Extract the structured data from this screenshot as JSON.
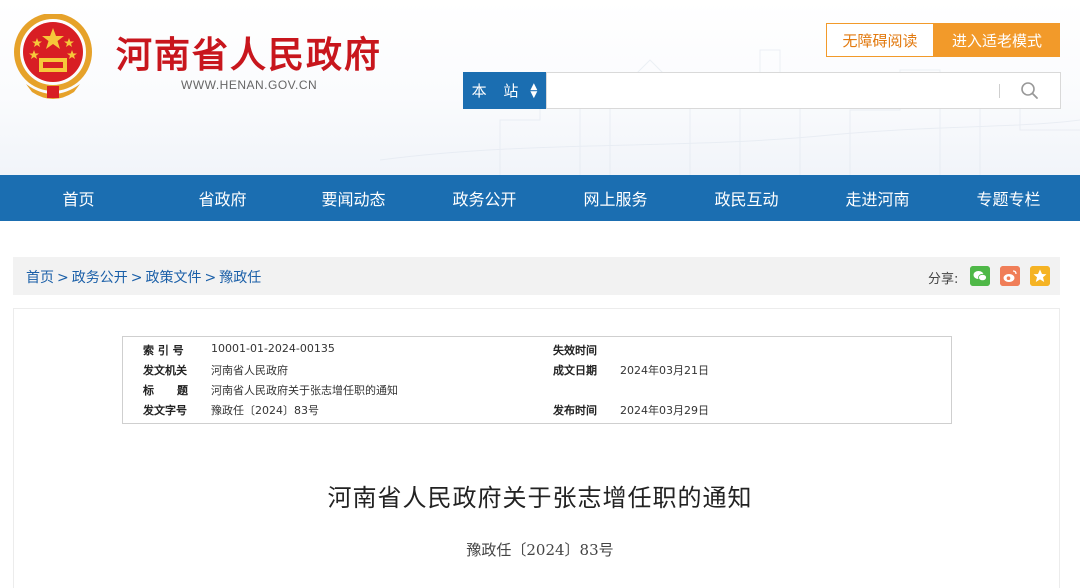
{
  "header": {
    "site_name": "河南省人民政府",
    "site_url": "WWW.HENAN.GOV.CN",
    "accessibility_label": "无障碍阅读",
    "elder_mode_label": "进入适老模式",
    "search": {
      "scope_label": "本 站",
      "placeholder": "",
      "value": ""
    }
  },
  "nav": {
    "items": [
      {
        "label": "首页"
      },
      {
        "label": "省政府"
      },
      {
        "label": "要闻动态"
      },
      {
        "label": "政务公开"
      },
      {
        "label": "网上服务"
      },
      {
        "label": "政民互动"
      },
      {
        "label": "走进河南"
      },
      {
        "label": "专题专栏"
      }
    ]
  },
  "breadcrumb": {
    "items": [
      "首页",
      "政务公开",
      "政策文件",
      "豫政任"
    ],
    "separator": ">"
  },
  "share": {
    "label": "分享:",
    "icons": [
      "wechat-icon",
      "weibo-icon",
      "favorite-icon"
    ]
  },
  "meta": {
    "index_label": "索 引 号",
    "index_value": "10001-01-2024-00135",
    "issuer_label": "发文机关",
    "issuer_value": "河南省人民政府",
    "title_label": "标      题",
    "title_value": "河南省人民政府关于张志增任职的通知",
    "docno_label": "发文字号",
    "docno_value": "豫政任〔2024〕83号",
    "expire_label": "失效时间",
    "expire_value": "",
    "created_label": "成文日期",
    "created_value": "2024年03月21日",
    "published_label": "发布时间",
    "published_value": "2024年03月29日"
  },
  "document": {
    "title": "河南省人民政府关于张志增任职的通知",
    "number": "豫政任〔2024〕83号"
  },
  "colors": {
    "brand_red": "#c8161d",
    "nav_blue": "#1b6eb1",
    "accent_orange": "#f29a2a",
    "link_blue": "#1a5fa8"
  }
}
